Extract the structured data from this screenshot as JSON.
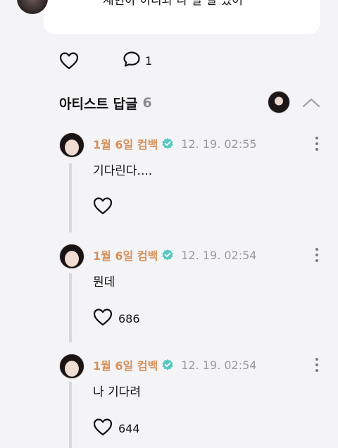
{
  "top_comment": {
    "text": "재현아 이리와 나 할 말 있어",
    "reply_count": "1"
  },
  "artist_replies": {
    "title": "아티스트 답글",
    "count": "6"
  },
  "replies": [
    {
      "name": "1월 6일 컴백",
      "time": "12. 19. 02:55",
      "text": "기다린다....",
      "likes": ""
    },
    {
      "name": "1월 6일 컴백",
      "time": "12. 19. 02:54",
      "text": "뭔데",
      "likes": "686"
    },
    {
      "name": "1월 6일 컴백",
      "time": "12. 19. 02:54",
      "text": "나 기다려",
      "likes": "644"
    }
  ],
  "colors": {
    "background": "#f4f4f6",
    "card": "#ffffff",
    "artist_name": "#d4915c",
    "verified_badge": "#5bc8c0",
    "timestamp": "#9a9a9a",
    "thread_line": "#d9d9dc"
  },
  "icons": {
    "like": "heart-outline-icon",
    "comment": "speech-bubble-icon",
    "verified": "verified-badge-icon",
    "collapse": "chevron-up-icon",
    "more": "vertical-dots-icon"
  }
}
